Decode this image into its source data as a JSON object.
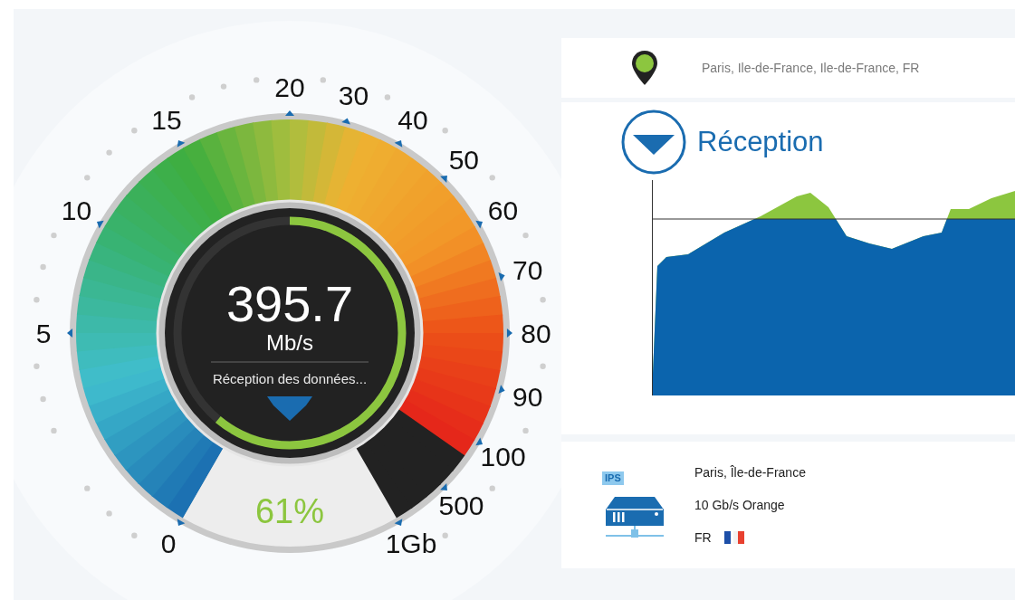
{
  "gauge": {
    "scale": [
      {
        "label": "0"
      },
      {
        "label": "5"
      },
      {
        "label": "10"
      },
      {
        "label": "15"
      },
      {
        "label": "20"
      },
      {
        "label": "30"
      },
      {
        "label": "40"
      },
      {
        "label": "50"
      },
      {
        "label": "60"
      },
      {
        "label": "70"
      },
      {
        "label": "80"
      },
      {
        "label": "90"
      },
      {
        "label": "100"
      },
      {
        "label": "500"
      },
      {
        "label": "1Gb"
      }
    ],
    "reading": "395.7",
    "unit": "Mb/s",
    "status": "Réception des données...",
    "progress": {
      "level": 0.61
    },
    "percent": "61%"
  },
  "location": {
    "text": "Paris, Ile-de-France, Ile-de-France, FR"
  },
  "reception": {
    "title": "Réception"
  },
  "server": {
    "badge": "IPS",
    "lines": [
      "Paris, Île-de-France",
      "10 Gb/s Orange"
    ],
    "country": "FR"
  }
}
